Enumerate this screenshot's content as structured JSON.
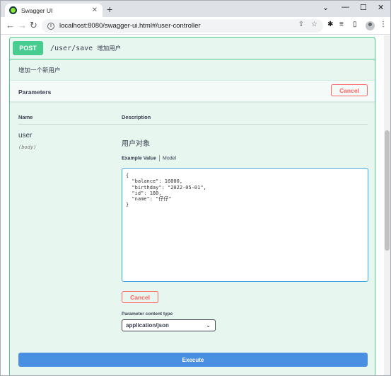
{
  "browser": {
    "tab_title": "Swagger UI",
    "tab_close": "✕",
    "new_tab": "+",
    "url": "localhost:8080/swagger-ui.html#/user-controller",
    "window_controls": [
      "⌄",
      "—",
      "☐",
      "✕"
    ]
  },
  "operation": {
    "method": "POST",
    "path": "/user/save",
    "summary": "增加用户",
    "description": "增加一个新用户"
  },
  "parameters": {
    "title": "Parameters",
    "cancel_label": "Cancel",
    "col_name": "Name",
    "col_description": "Description",
    "param_name": "user",
    "param_in": "(body)",
    "param_description": "用户对象",
    "example_value_tab": "Example Value",
    "model_tab": "Model",
    "body_value": "{\n  \"balance\": 16000,\n  \"birthday\": \"2022-05-01\",\n  \"id\": 180,\n  \"name\": \"仔仔\"\n}",
    "cancel_label_bottom": "Cancel",
    "content_type_label": "Parameter content type",
    "content_type_value": "application/json"
  },
  "execute_label": "Execute",
  "colors": {
    "post": "#49cc90",
    "post_bg": "#e8f6f0",
    "cancel": "#ff6060",
    "execute": "#4990e2"
  }
}
